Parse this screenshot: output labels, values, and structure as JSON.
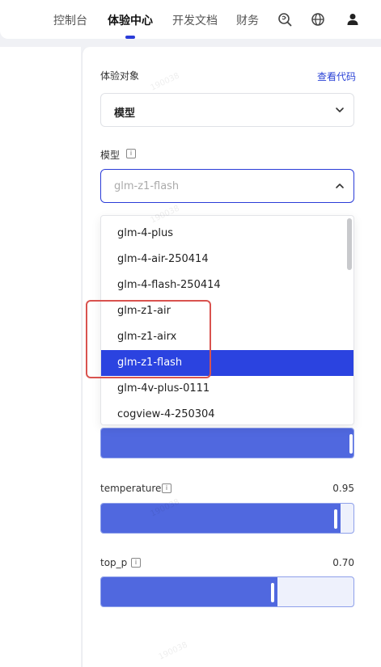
{
  "header": {
    "nav": [
      "控制台",
      "体验中心",
      "开发文档",
      "财务"
    ],
    "active_index": 1,
    "icons": [
      "search-brain-icon",
      "globe-icon",
      "user-icon"
    ]
  },
  "panel": {
    "target_label": "体验对象",
    "view_code_link": "查看代码",
    "target_value": "模型",
    "model_label": "模型",
    "model_selected": "glm-z1-flash"
  },
  "dropdown": {
    "options": [
      "glm-4-plus",
      "glm-4-air-250414",
      "glm-4-flash-250414",
      "glm-z1-air",
      "glm-z1-airx",
      "glm-z1-flash",
      "glm-4v-plus-0111",
      "cogview-4-250304"
    ],
    "selected_index": 5
  },
  "params": {
    "temperature_label": "temperature",
    "temperature_value": "0.95",
    "temperature_fill": 0.95,
    "top_p_label": "top_p",
    "top_p_value": "0.70",
    "top_p_fill": 0.7
  },
  "watermark": "190038",
  "colors": {
    "accent": "#2b43e0",
    "slider_fill": "#5068df",
    "highlight": "#d9534f"
  }
}
